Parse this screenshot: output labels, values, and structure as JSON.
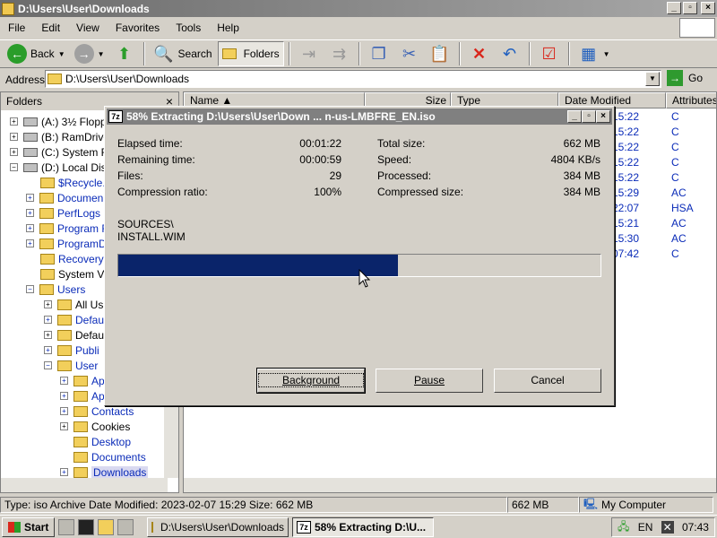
{
  "window": {
    "title": "D:\\Users\\User\\Downloads"
  },
  "menu": [
    "File",
    "Edit",
    "View",
    "Favorites",
    "Tools",
    "Help"
  ],
  "toolbar": {
    "back": "Back",
    "search": "Search",
    "folders": "Folders"
  },
  "address": {
    "label": "Address",
    "value": "D:\\Users\\User\\Downloads",
    "go": "Go"
  },
  "folders_pane": {
    "title": "Folders",
    "close": "×",
    "items": [
      "(A:) 3½ Floppy",
      "(B:) RamDrive",
      "(C:) System R",
      "(D:) Local Disk",
      "$Recycle.",
      "Documen",
      "PerfLogs",
      "Program F",
      "ProgramD",
      "Recovery",
      "System Vo",
      "Users",
      "All Us",
      "Defau",
      "Defau",
      "Publi",
      "User",
      "Ap",
      "Ap",
      "Contacts",
      "Cookies",
      "Desktop",
      "Documents",
      "Downloads"
    ]
  },
  "list": {
    "columns": [
      "Name",
      "Size",
      "Type",
      "Date Modified",
      "Attributes"
    ],
    "rows": [
      {
        "time": "15:22",
        "attr": "C"
      },
      {
        "time": "15:22",
        "attr": "C"
      },
      {
        "time": "15:22",
        "attr": "C"
      },
      {
        "time": "15:22",
        "attr": "C"
      },
      {
        "time": "15:22",
        "attr": "C"
      },
      {
        "time": "15:29",
        "attr": "AC"
      },
      {
        "time": "22:07",
        "attr": "HSA"
      },
      {
        "time": "15:21",
        "attr": "AC"
      },
      {
        "time": "15:30",
        "attr": "AC"
      },
      {
        "time": "07:42",
        "attr": "C"
      }
    ]
  },
  "status": {
    "info": "Type: iso Archive Date Modified: 2023-02-07 15:29 Size: 662 MB",
    "size": "662 MB",
    "location": "My Computer"
  },
  "dialog": {
    "title": "58% Extracting D:\\Users\\User\\Down ... n-us-LMBFRE_EN.iso",
    "icon": "7z",
    "elapsed_label": "Elapsed time:",
    "elapsed": "00:01:22",
    "remaining_label": "Remaining time:",
    "remaining": "00:00:59",
    "files_label": "Files:",
    "files": "29",
    "ratio_label": "Compression ratio:",
    "ratio": "100%",
    "total_label": "Total size:",
    "total": "662 MB",
    "speed_label": "Speed:",
    "speed": "4804 KB/s",
    "processed_label": "Processed:",
    "processed": "384 MB",
    "compressed_label": "Compressed size:",
    "compressed": "384 MB",
    "path_line1": "SOURCES\\",
    "path_line2": "INSTALL.WIM",
    "progress_fraction": 0.58,
    "btn_background": "Background",
    "btn_pause": "Pause",
    "btn_cancel": "Cancel"
  },
  "taskbar": {
    "start": "Start",
    "task1": "D:\\Users\\User\\Downloads",
    "task2": "58% Extracting D:\\U...",
    "lang": "EN",
    "clock": "07:43"
  }
}
